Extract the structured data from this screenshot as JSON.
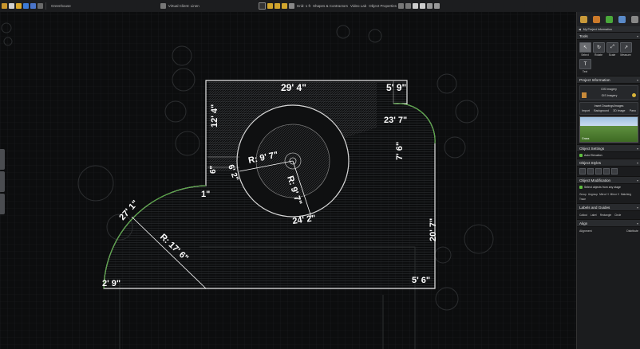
{
  "topbar": {
    "doc_label": "Greenhouse",
    "file_label": "Virtual Client: Linen",
    "zoom_label": "Grid: 1 ft",
    "shapes_label": "Shapes & Contractors",
    "video_label": "Video Lab",
    "object_props_label": "Object Properties"
  },
  "canvas": {
    "dimensions": [
      "29' 4\"",
      "5' 9\"",
      "12' 4\"",
      "23' 7\"",
      "7' 6\"",
      "R: 9' 7\"",
      "6' 2\"",
      "6\"",
      "1\"",
      "R: 9' 7\"",
      "24' 2\"",
      "27' 1\"",
      "R: 17' 6\"",
      "20' 7\"",
      "2' 9\"",
      "5' 6\""
    ]
  },
  "panel": {
    "nav_title": "My Project Information",
    "tools_title": "Tools",
    "tools": [
      "Select",
      "Rotate",
      "Scale",
      "Measure",
      "Text"
    ],
    "project_info_title": "Project Information",
    "imagery_label": "GIS Imagery",
    "imagery_btn": "GIS Imagery",
    "insert_label": "Insert Drawings/Images",
    "insert_items": [
      "Import",
      "Background",
      "3D Image",
      "Pano"
    ],
    "thumb_label": "Grass",
    "object_settings_title": "Object Settings",
    "auto_elevation_label": "Auto Elevation",
    "object_styles_title": "Object Styles",
    "object_mod_title": "Object Modification",
    "select_objects_label": "Select objects from any stage",
    "mod_items": [
      "Group",
      "Ungroup",
      "Mirror H",
      "Mirror V",
      "Matching",
      "",
      "",
      "Trace"
    ],
    "labels_guides_title": "Labels and Guides",
    "label_items": [
      "Callout",
      "Label",
      "Rectangle",
      "Circle"
    ],
    "align_title": "Align",
    "alignment_label": "Alignment",
    "distribute_label": "Distribute"
  },
  "colors": {
    "accent_green": "#5fbf3f",
    "panel_bg": "#1b1c1e",
    "canvas_bg": "#0c0d0e"
  }
}
